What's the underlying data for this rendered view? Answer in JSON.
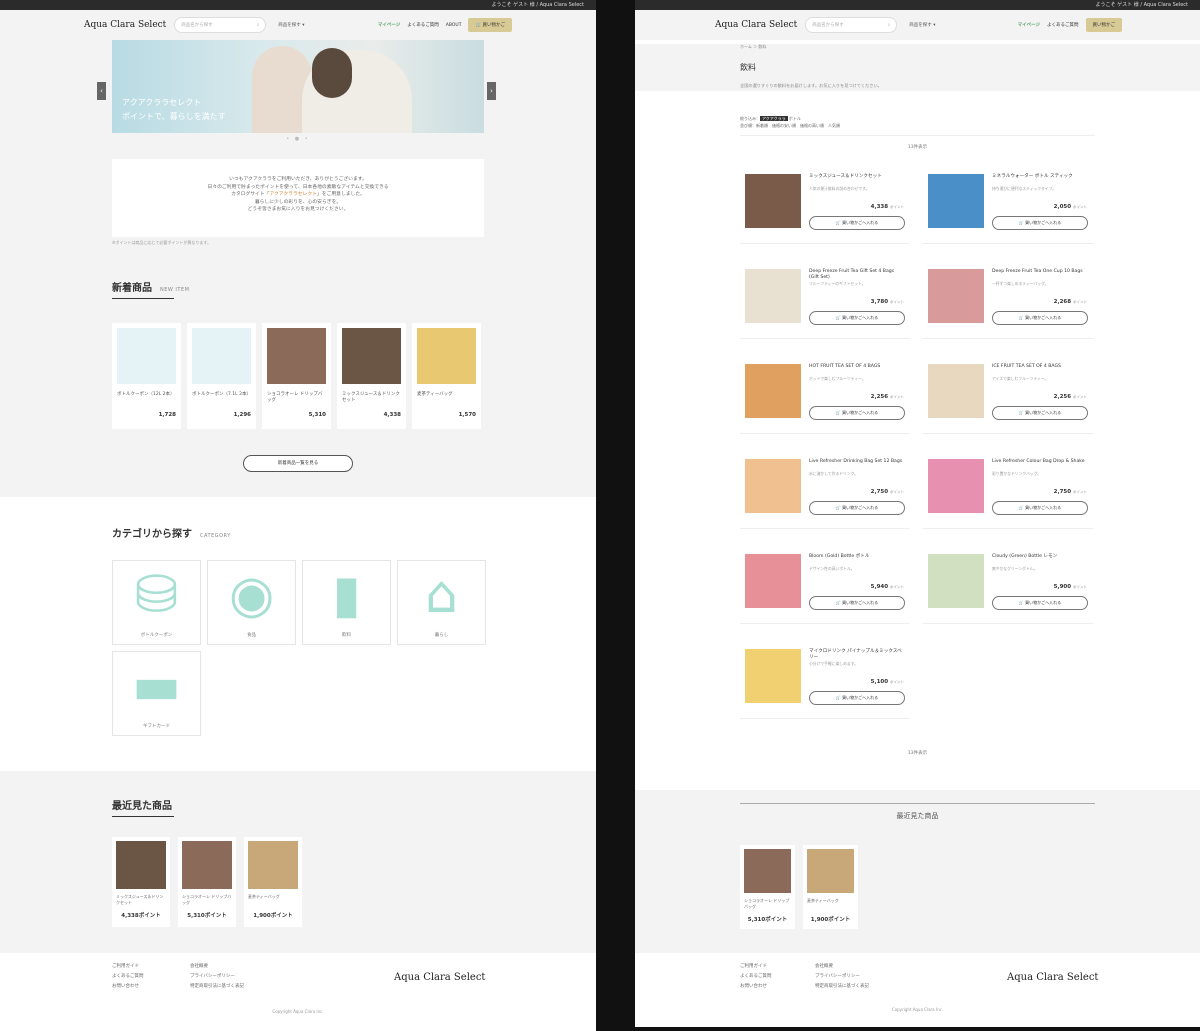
{
  "brand": {
    "logo": "Aqua Clara Select"
  },
  "left": {
    "topbar": "ようこそ ゲスト 様 / Aqua Clara Select",
    "search_placeholder": "商品名から探す",
    "category_select": "商品を探す ▾",
    "mypage": "マイページ",
    "faq": "よくあるご質問",
    "about": "ABOUT",
    "cart": "買い物かご",
    "hero": {
      "line1": "アクアクララセレクト",
      "line2": "ポイントで、暮らしを満たす"
    },
    "notice": {
      "l1": "いつもアクアクララをご利用いただき、ありがとうございます。",
      "l2": "日々のご利用で貯まったポイントを使って、日本各地の素敵なアイテムと交換できる",
      "l3a": "カタログサイト「",
      "l3b": "アクアクララセレクト",
      "l3c": "」をご用意しました。",
      "l4": "暮らしに少しの彩りを、心の安らぎを。",
      "l5": "どうぞ皆さまお気に入りをお見つけください。"
    },
    "note": "※ポイントは商品に応じて必要ポイントが異なります。",
    "new": {
      "title": "新着商品",
      "en": "NEW ITEM",
      "more": "新着商品一覧を見る",
      "items": [
        {
          "name": "ボトルクーポン（12L 2本）",
          "price": "1,728"
        },
        {
          "name": "ボトルクーポン（7.1L 2本）",
          "price": "1,296"
        },
        {
          "name": "ショコラオーレ ドリップバッグ",
          "price": "5,310"
        },
        {
          "name": "ミックスジュース＆ドリンクセット",
          "price": "4,338"
        },
        {
          "name": "麦茶ティーバッグ",
          "price": "1,570"
        }
      ]
    },
    "category": {
      "title": "カテゴリから探す",
      "en": "CATEGORY",
      "items": [
        "ボトルクーポン",
        "食品",
        "飲料",
        "暮らし",
        "ギフトカード"
      ]
    },
    "recent": {
      "title": "最近見た商品",
      "items": [
        {
          "name": "ミックスジュース＆ドリンクセット",
          "price": "4,338ポイント"
        },
        {
          "name": "ショコラオーレ ドリップバッグ",
          "price": "5,310ポイント"
        },
        {
          "name": "麦茶ティーバッグ",
          "price": "1,900ポイント"
        }
      ]
    },
    "footer": {
      "c1": [
        "ご利用ガイド",
        "よくあるご質問",
        "お問い合わせ"
      ],
      "c2": [
        "会社概要",
        "プライバシーポリシー",
        "特定商取引法に基づく表記"
      ],
      "copy": "Copyright Aqua Clara Inc."
    }
  },
  "right": {
    "breadcrumb": "ホーム ＞ 飲料",
    "title": "飲料",
    "desc": "全国の選りすぐりの飲料をお届けします。お気に入りを見つけてください。",
    "filters": {
      "l1a": "絞り込み：",
      "chip": "アクアクララ",
      "l1b": "ボトル",
      "l2": "並び順：新着順　価格の安い順　価格の高い順　人気順"
    },
    "count": "13件表示",
    "items": [
      {
        "name": "ミックスジュース＆ドリンクセット",
        "desc": "人気の果汁飲料の詰め合わせです。",
        "price": "4,338"
      },
      {
        "name": "ミネラルウォーター ボトル スティック",
        "desc": "持ち運びに便利なスティックタイプ。",
        "price": "2,050"
      },
      {
        "name": "Deep Freeze Fruit Tea Gift Set 4 Bags (Gift Set)",
        "desc": "フルーツティーのギフトセット。",
        "price": "3,780"
      },
      {
        "name": "Deep Freeze Fruit Tea One Cup 10 Bags",
        "desc": "一杯ずつ楽しめるティーバッグ。",
        "price": "2,268"
      },
      {
        "name": "HOT FRUIT TEA SET OF 4 BAGS",
        "desc": "ホットで楽しむフルーツティー。",
        "price": "2,256"
      },
      {
        "name": "ICE FRUIT TEA SET OF 4 BAGS",
        "desc": "アイスで楽しむフルーツティー。",
        "price": "2,256"
      },
      {
        "name": "Live Refresher Drinking Bag Set 12 Bags",
        "desc": "水に溶かして作るドリンク。",
        "price": "2,750"
      },
      {
        "name": "Live Refresher Colour Bag Drop & Shake",
        "desc": "彩り豊かなドリンクバッグ。",
        "price": "2,750"
      },
      {
        "name": "Bloom (Gold) Bottle ボトル",
        "desc": "デザイン性の高いボトル。",
        "price": "5,940"
      },
      {
        "name": "Cloudy (Green) Bottle レモン",
        "desc": "爽やかなグリーンボトル。",
        "price": "5,900"
      },
      {
        "name": "マイクロドリンク パイナップル＆ミックスベリー",
        "desc": "小分けで手軽に楽しめます。",
        "price": "5,100"
      }
    ],
    "btn": "買い物かごへ入れる",
    "pt": "ポイント",
    "count2": "13件表示",
    "recent": {
      "title": "最近見た商品",
      "items": [
        {
          "name": "ショコラオーレ ドリップバッグ",
          "price": "5,310ポイント"
        },
        {
          "name": "麦茶ティーバッグ",
          "price": "1,900ポイント"
        }
      ]
    }
  }
}
